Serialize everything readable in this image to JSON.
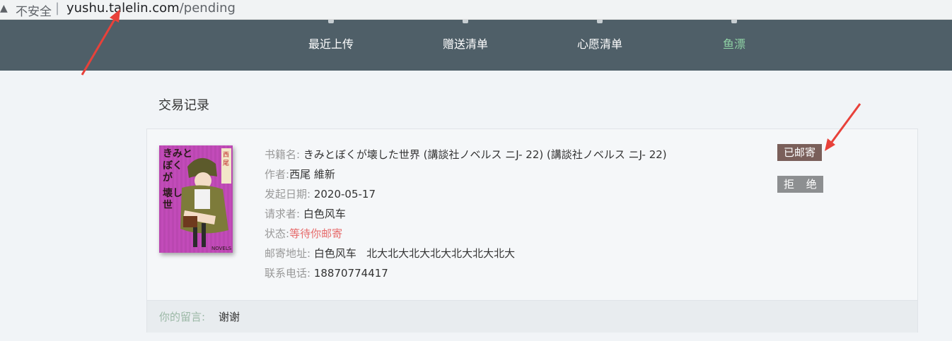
{
  "browser": {
    "security_label": "不安全",
    "separator": "|",
    "url_domain": "yushu.talelin.com",
    "url_path": "/pending"
  },
  "nav": {
    "items": [
      {
        "label": "最近上传",
        "active": false
      },
      {
        "label": "赠送清单",
        "active": false
      },
      {
        "label": "心愿清单",
        "active": false
      },
      {
        "label": "鱼漂",
        "active": true
      }
    ]
  },
  "page": {
    "title": "交易记录"
  },
  "record": {
    "book_title_label": "书籍名:",
    "book_title": "きみとぼくが壊した世界 (講談社ノベルス ニJ- 22) (講談社ノベルス ニJ- 22)",
    "author_label": "作者:",
    "author": "西尾 維新",
    "date_label": "发起日期:",
    "date": "2020-05-17",
    "requester_label": "请求者:",
    "requester": "白色风车",
    "status_label": "状态:",
    "status": "等待你邮寄",
    "address_label": "邮寄地址:",
    "address": "白色风车   北大北大北大北大北大北大北大",
    "phone_label": "联系电话:",
    "phone": "18870774417",
    "message_label": "你的留言:",
    "message": "谢谢",
    "cover_text": "きみとぼくが壊した世界",
    "cover_author": "西尾維新"
  },
  "actions": {
    "mailed_label": "已邮寄",
    "reject_label": "拒 绝"
  },
  "colors": {
    "nav_bg": "#4f5f68",
    "nav_active": "#8fd3a5",
    "status": "#e66a6a",
    "mailed_btn": "#7a5f5a",
    "reject_btn": "#8d8f91",
    "arrow": "#e8413a"
  }
}
